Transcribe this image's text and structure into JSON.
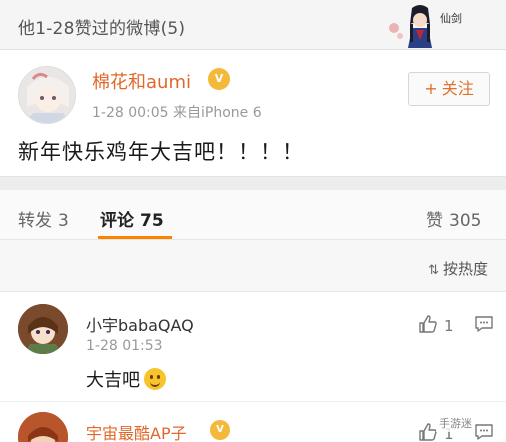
{
  "header": {
    "title": "他1-28赞过的微博(5)",
    "art_label": "仙剑"
  },
  "post": {
    "author": "棉花和aumi",
    "vip_icon": "vip-crown-icon",
    "time": "1-28 00:05",
    "source": "来自iPhone 6",
    "follow_label": "关注",
    "text": "新年快乐鸡年大吉吧！！！！"
  },
  "tabs": [
    {
      "label": "转发",
      "count": "3"
    },
    {
      "label": "评论",
      "count": "75"
    },
    {
      "label": "赞",
      "count": "305"
    }
  ],
  "sort": {
    "label": "按热度"
  },
  "comments": [
    {
      "name": "小宇babaQAQ",
      "time": "1-28 01:53",
      "text": "大吉吧",
      "likes": "1"
    },
    {
      "name": "宇宙最酷AP子",
      "likes": "1"
    }
  ],
  "watermark": "手游迷",
  "colors": {
    "accent": "#ff8200",
    "name_orange": "#e1682a",
    "muted": "#999999"
  }
}
